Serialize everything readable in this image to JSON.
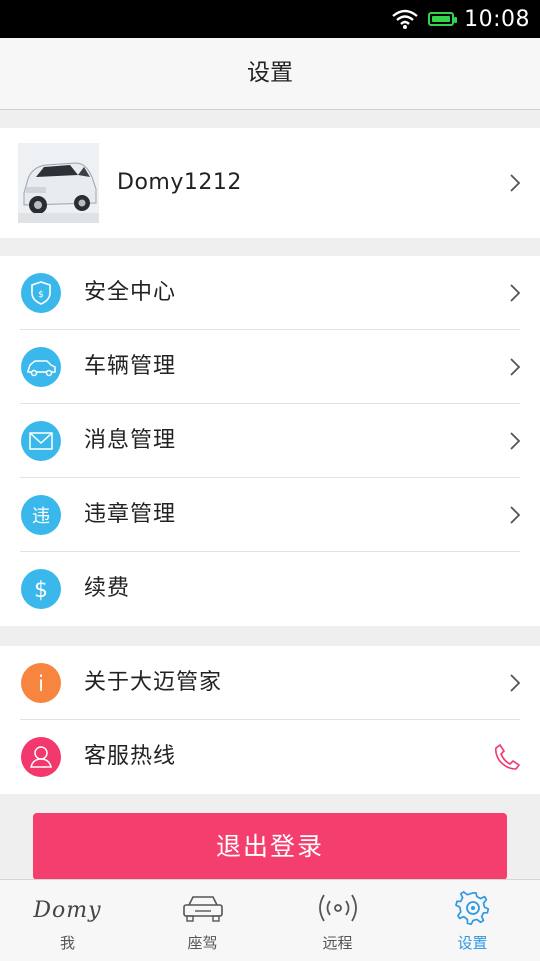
{
  "status_bar": {
    "time": "10:08",
    "wifi_icon": "wifi-icon",
    "battery_icon": "battery-icon"
  },
  "header": {
    "title": "设置"
  },
  "profile": {
    "username": "Domy1212",
    "avatar_icon": "car-photo"
  },
  "menu_group_1": [
    {
      "label": "安全中心",
      "icon": "shield-icon",
      "chevron": true
    },
    {
      "label": "车辆管理",
      "icon": "car-icon",
      "chevron": true
    },
    {
      "label": "消息管理",
      "icon": "envelope-icon",
      "chevron": true
    },
    {
      "label": "违章管理",
      "icon": "violation-icon",
      "icon_text": "违",
      "chevron": true
    },
    {
      "label": "续费",
      "icon": "dollar-icon",
      "icon_text": "$",
      "chevron": false
    }
  ],
  "menu_group_2": [
    {
      "label": "关于大迈管家",
      "icon": "info-icon",
      "icon_text": "i",
      "chevron": true
    },
    {
      "label": "客服热线",
      "icon": "user-icon",
      "action_icon": "phone-icon"
    }
  ],
  "logout": {
    "label": "退出登录"
  },
  "tabbar": {
    "tabs": [
      {
        "label": "我",
        "icon": "domy-logo-icon",
        "logo_text": "Domy",
        "active": false
      },
      {
        "label": "座驾",
        "icon": "car-icon",
        "active": false
      },
      {
        "label": "远程",
        "icon": "remote-signal-icon",
        "active": false
      },
      {
        "label": "设置",
        "icon": "gear-icon",
        "active": true
      }
    ]
  },
  "colors": {
    "accent_blue": "#3ab8ec",
    "accent_orange": "#f7843f",
    "accent_pink": "#f2386d",
    "logout_button": "#f43e6e",
    "active_tab": "#2f9ae0"
  }
}
